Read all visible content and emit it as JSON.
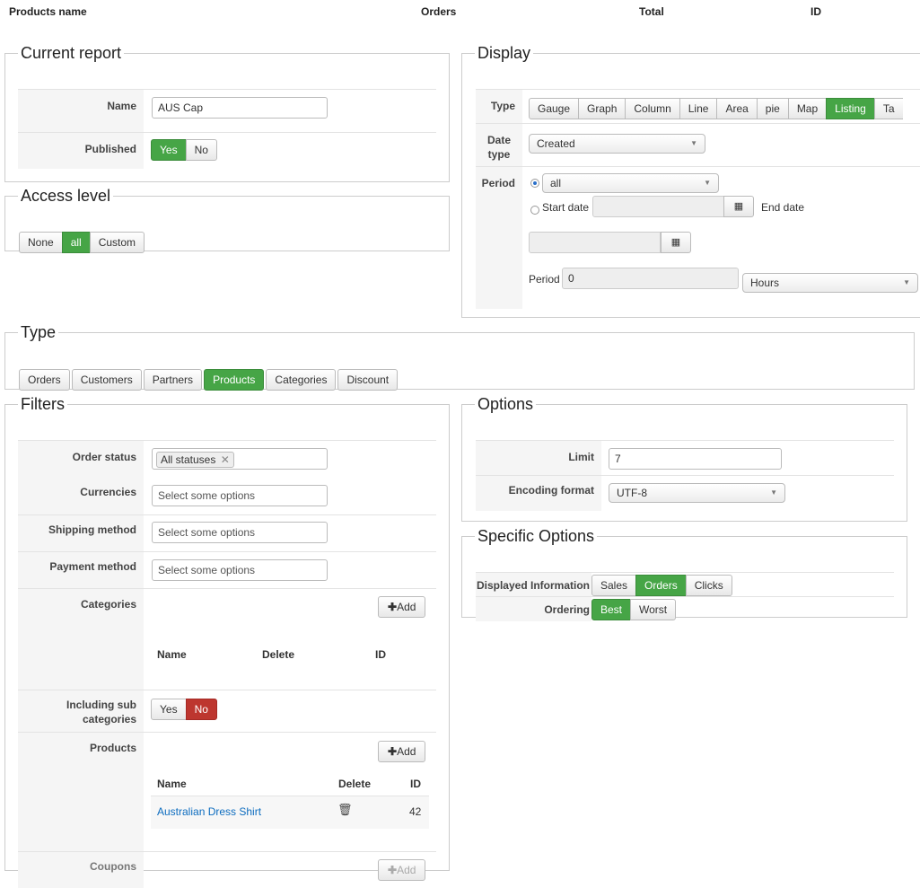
{
  "top_header": {
    "products_name": "Products name",
    "orders": "Orders",
    "total": "Total",
    "id": "ID"
  },
  "current_report": {
    "legend": "Current report",
    "name_label": "Name",
    "name_value": "AUS Cap",
    "published_label": "Published",
    "published_yes": "Yes",
    "published_no": "No"
  },
  "access_level": {
    "legend": "Access level",
    "options": [
      "None",
      "all",
      "Custom"
    ]
  },
  "display": {
    "legend": "Display",
    "type_label": "Type",
    "type_options": [
      "Gauge",
      "Graph",
      "Column",
      "Line",
      "Area",
      "pie",
      "Map",
      "Listing",
      "Ta"
    ],
    "date_type_label": "Date type",
    "date_type_value": "Created",
    "period_label": "Period",
    "period_value": "all",
    "start_date_label": "Start date",
    "end_date_label": "End date",
    "period_inline_label": "Period",
    "period_number": "0",
    "period_unit": "Hours"
  },
  "type_section": {
    "legend": "Type",
    "options": [
      "Orders",
      "Customers",
      "Partners",
      "Products",
      "Categories",
      "Discount"
    ]
  },
  "filters": {
    "legend": "Filters",
    "order_status_label": "Order status",
    "order_status_tag": "All statuses",
    "currencies_label": "Currencies",
    "shipping_label": "Shipping method",
    "payment_label": "Payment method",
    "placeholder": "Select some options",
    "categories_label": "Categories",
    "add_label": "Add",
    "col_name": "Name",
    "col_delete": "Delete",
    "col_id": "ID",
    "including_sub_label": "Including sub categories",
    "yes": "Yes",
    "no": "No",
    "products_label": "Products",
    "product_row": {
      "name": "Australian Dress Shirt",
      "id": "42"
    },
    "coupons_label": "Coupons"
  },
  "options": {
    "legend": "Options",
    "limit_label": "Limit",
    "limit_value": "7",
    "encoding_label": "Encoding format",
    "encoding_value": "UTF-8"
  },
  "specific_options": {
    "legend": "Specific Options",
    "displayed_info_label": "Displayed Information",
    "displayed_info_options": [
      "Sales",
      "Orders",
      "Clicks"
    ],
    "ordering_label": "Ordering",
    "ordering_options": [
      "Best",
      "Worst"
    ]
  },
  "colors": {
    "active_green": "#46a546",
    "active_red": "#bd362f",
    "link": "#0c6cbf"
  }
}
